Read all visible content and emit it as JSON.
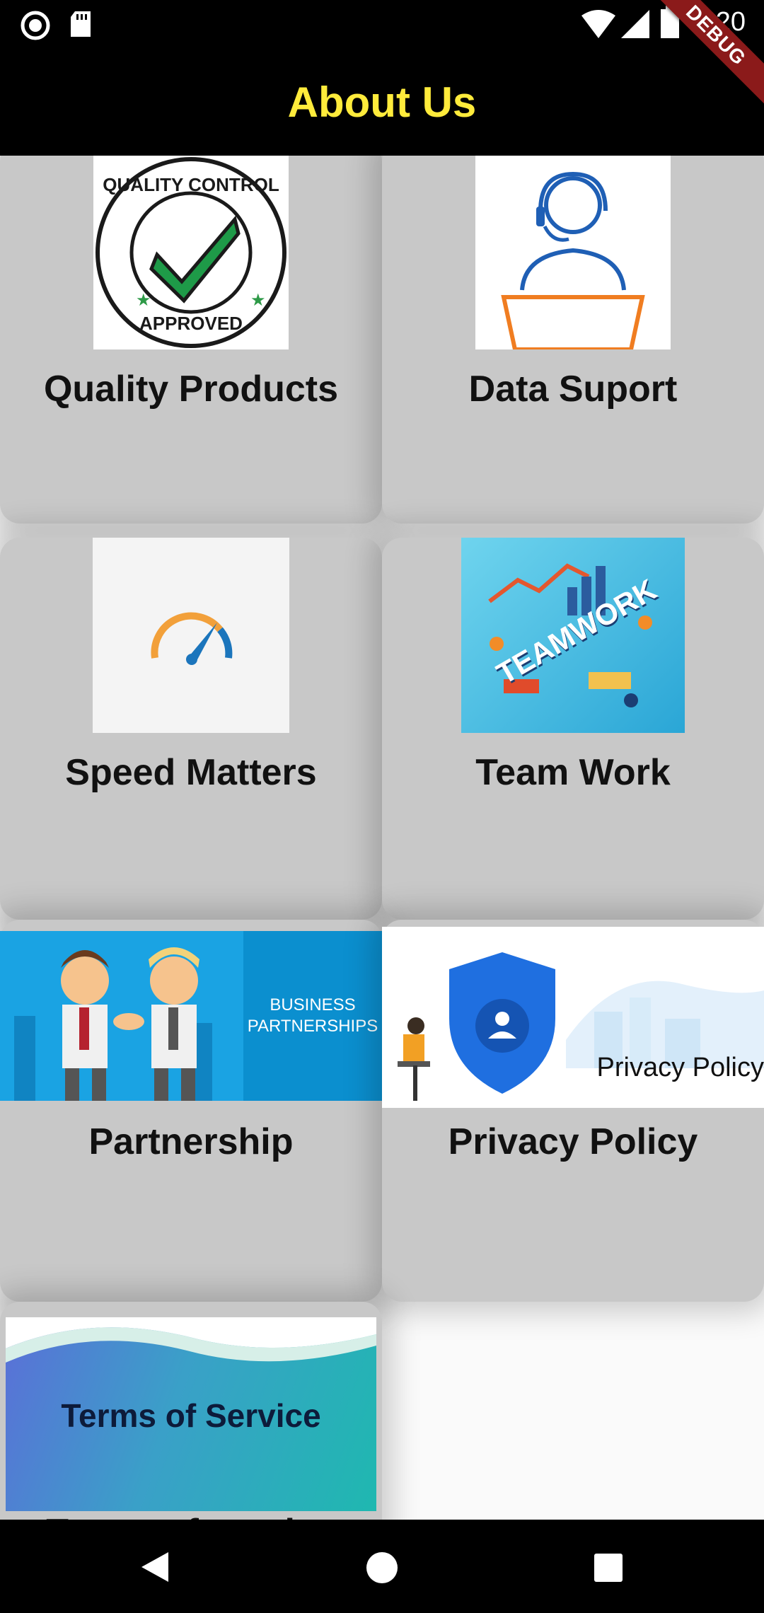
{
  "status_bar": {
    "time": "8:20"
  },
  "debug_banner": "DEBUG",
  "app_bar": {
    "title": "About Us"
  },
  "cards": [
    {
      "title": "Quality Products",
      "image": {
        "ring_top": "QUALITY CONTROL",
        "ring_bottom": "APPROVED"
      }
    },
    {
      "title": "Data Suport"
    },
    {
      "title": "Speed Matters"
    },
    {
      "title": "Team Work",
      "image": {
        "banner": "TEAMWORK"
      }
    },
    {
      "title": "Partnership",
      "image": {
        "line1": "BUSINESS",
        "line2": "PARTNERSHIPS"
      }
    },
    {
      "title": "Privacy Policy",
      "image": {
        "caption": "Privacy Policy"
      }
    },
    {
      "title": "Terms of service",
      "image": {
        "caption": "Terms of Service"
      }
    }
  ]
}
